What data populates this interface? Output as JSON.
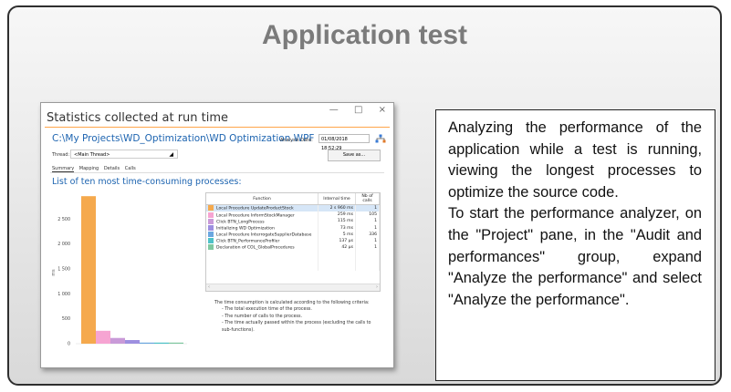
{
  "page": {
    "title": "Application test"
  },
  "screenshot": {
    "window_buttons": [
      "—",
      "□",
      "×"
    ],
    "title": "Statistics collected at run time",
    "path": "C:\\My Projects\\WD_Optimization\\WD Optimization.WPF",
    "analysis_date_label": "Analysis Date:",
    "analysis_date": "01/08/2018 18:52:29",
    "thread_label": "Thread:",
    "thread_value": "<Main Thread>",
    "save_as": "Save as...",
    "tabs": [
      "Summary",
      "Mapping",
      "Details",
      "Calls"
    ],
    "heading": "List of ten most time-consuming processes:",
    "table": {
      "columns": [
        "Function",
        "Internal time",
        "Nb of calls"
      ],
      "rows": [
        {
          "color": "#f5a94d",
          "function": "Local Procedure UpdateProductStock",
          "time": "2 s 960 ms",
          "calls": "1"
        },
        {
          "color": "#f6a4d2",
          "function": "Local Procedure InformStockManager",
          "time": "259 ms",
          "calls": "105"
        },
        {
          "color": "#c99ad8",
          "function": "Click BTN_LongProcess",
          "time": "115 ms",
          "calls": "1"
        },
        {
          "color": "#9d8fe0",
          "function": "Initializing WD Optimization",
          "time": "73 ms",
          "calls": "1"
        },
        {
          "color": "#6ba7e0",
          "function": "Local Procedure InterrogateSupplierDatabase",
          "time": "5 ms",
          "calls": "336"
        },
        {
          "color": "#4fc2c8",
          "function": "Click BTN_PerformanceProfiler",
          "time": "137 µs",
          "calls": "1"
        },
        {
          "color": "#7fc8a0",
          "function": "Declaration of COL_GlobalProcedures",
          "time": "42 µs",
          "calls": "1"
        }
      ]
    },
    "criteria": {
      "intro": "The time consumption is calculated according to the following criteria:",
      "items": [
        "- The total execution time of the process.",
        "- The number of calls to the process.",
        "- The time actually passed within the process (excluding the calls to sub-functions)."
      ]
    }
  },
  "chart_data": {
    "type": "bar",
    "ylabel": "ms",
    "yticks": [
      "2 500",
      "2 000",
      "1 500",
      "1 000",
      "500",
      "0"
    ],
    "ytick_values": [
      2500,
      2000,
      1500,
      1000,
      500,
      0
    ],
    "ylim": [
      0,
      3000
    ],
    "categories": [
      "Local Procedure UpdateProductStock",
      "Local Procedure InformStockManager",
      "Click BTN_LongProcess",
      "Initializing WD Optimization",
      "Local Procedure InterrogateSupplierDatabase",
      "Click BTN_PerformanceProfiler",
      "Declaration of COL_GlobalProcedures"
    ],
    "values": [
      2960,
      259,
      115,
      73,
      5,
      0.137,
      0.042
    ],
    "colors": [
      "#f5a94d",
      "#f6a4d2",
      "#c99ad8",
      "#9d8fe0",
      "#6ba7e0",
      "#4fc2c8",
      "#7fc8a0"
    ]
  },
  "description": {
    "paragraphs": [
      "Analyzing the performance of the application while a test is running, viewing the longest processes to optimize the source code.",
      "To start the performance analyzer, on the \"Project\" pane, in the \"Audit and performances\" group, expand \"Analyze the performance\" and select \"Analyze the performance\"."
    ]
  }
}
